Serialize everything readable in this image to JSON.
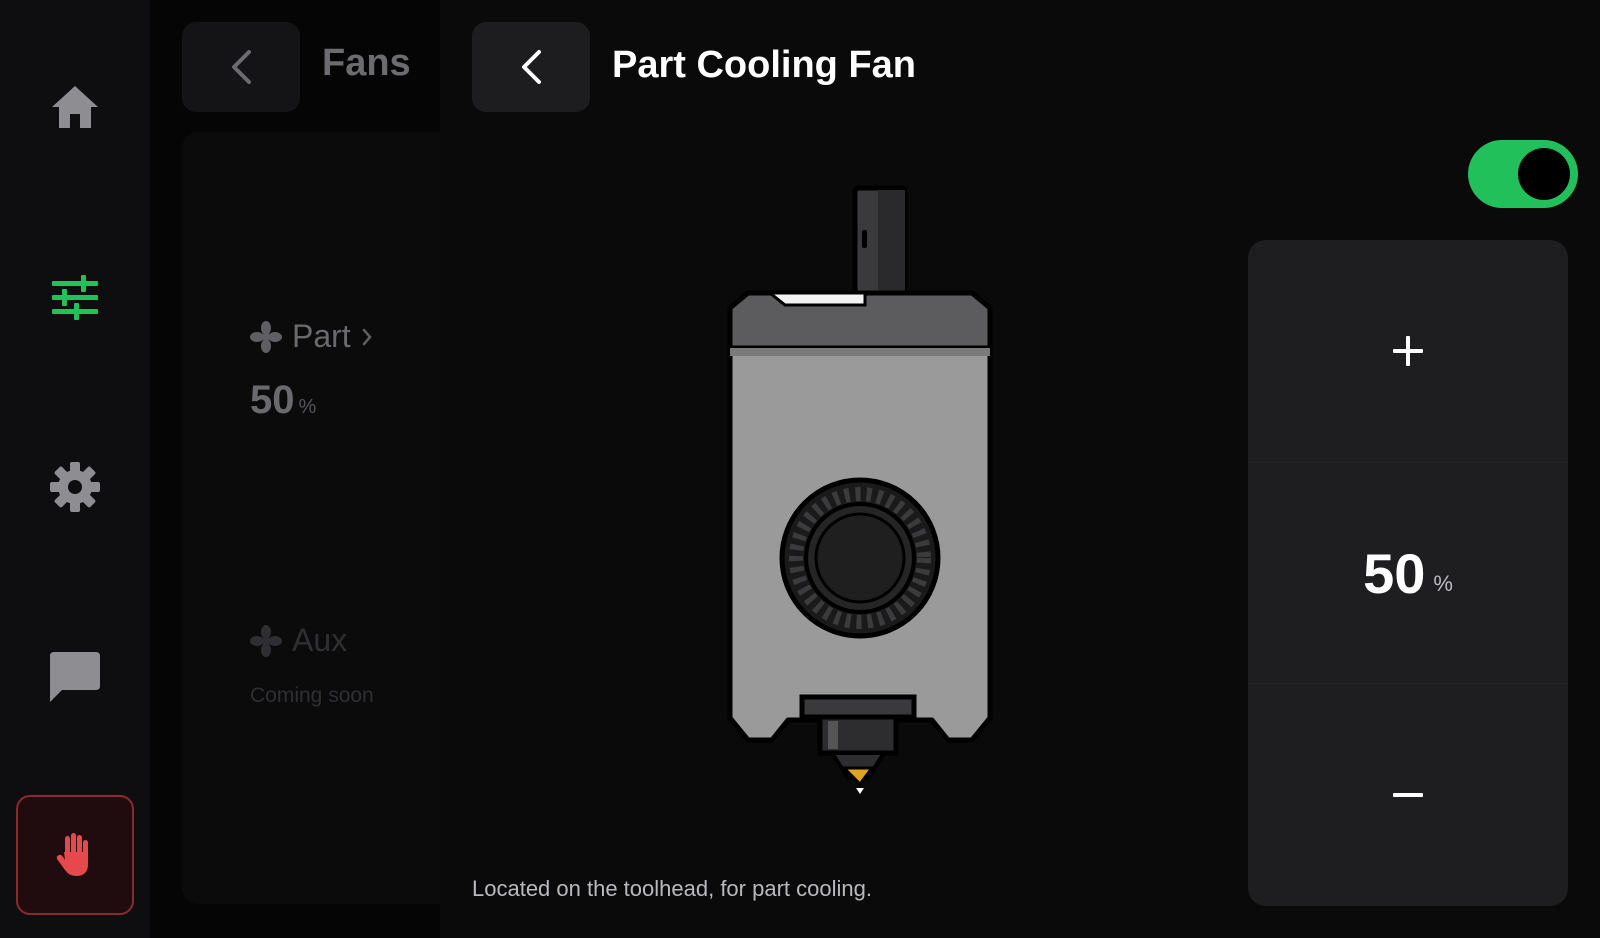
{
  "sidebar": {
    "items": [
      {
        "icon": "home-icon",
        "active": false
      },
      {
        "icon": "sliders-icon",
        "active": true
      },
      {
        "icon": "gear-icon",
        "active": false
      },
      {
        "icon": "chat-icon",
        "active": false
      }
    ],
    "emergency_stop_icon": "hand-stop-icon"
  },
  "previous_panel": {
    "title": "Fans",
    "fans": [
      {
        "label": "Part",
        "value": "50",
        "unit": "%"
      },
      {
        "label": "Aux",
        "subtitle": "Coming soon"
      }
    ]
  },
  "detail": {
    "title": "Part Cooling Fan",
    "description": "Located on the toolhead, for part cooling.",
    "enabled": true,
    "speed": {
      "value": "50",
      "unit": "%"
    }
  },
  "colors": {
    "accent": "#22c05a",
    "danger": "#e5484d",
    "panel": "#1e1e21",
    "background": "#0a0a0b"
  }
}
